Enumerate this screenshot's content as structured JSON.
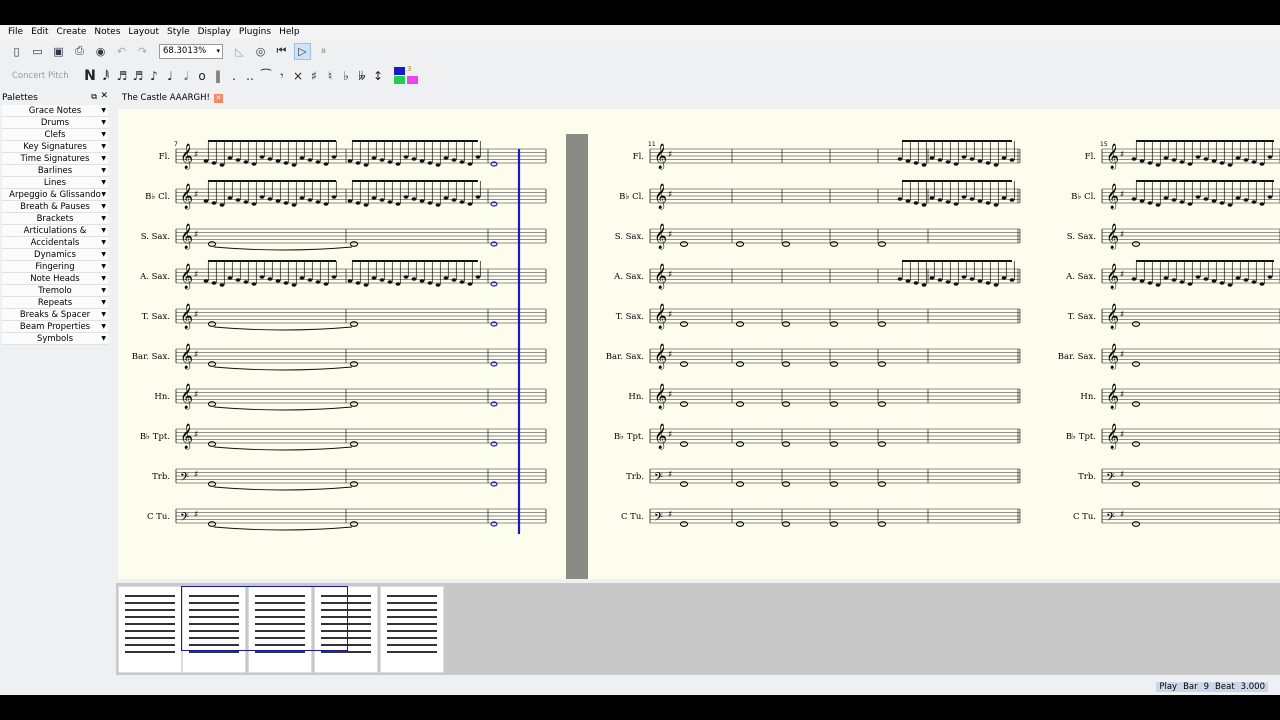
{
  "menu": [
    "File",
    "Edit",
    "Create",
    "Notes",
    "Layout",
    "Style",
    "Display",
    "Plugins",
    "Help"
  ],
  "toolbar": {
    "zoom": "68.3013%",
    "icons": [
      "new-file-icon",
      "open-file-icon",
      "save-icon",
      "print-icon",
      "mixer-icon",
      "undo-icon",
      "redo-icon"
    ],
    "playback_icons": [
      "metronome-icon",
      "loop-icon",
      "rewind-icon",
      "play-icon",
      "pause-icon"
    ]
  },
  "note_input": {
    "concert_pitch": "Concert Pitch",
    "note_mode": "N",
    "voices_label": "3",
    "voice_colors": [
      "#1a1acc",
      "#ee44ee",
      "#22cc55",
      "#3344ff"
    ]
  },
  "palettes": {
    "title": "Palettes",
    "items": [
      "Grace Notes",
      "Drums",
      "Clefs",
      "Key Signatures",
      "Time Signatures",
      "Barlines",
      "Lines",
      "Arpeggio & Glissando",
      "Breath & Pauses",
      "Brackets",
      "Articulations & Ornaments",
      "Accidentals",
      "Dynamics",
      "Fingering",
      "Note Heads",
      "Tremolo",
      "Repeats",
      "Breaks & Spacer",
      "Beam Properties",
      "Symbols"
    ]
  },
  "score_tab": {
    "title": "The Castle AAARGH!"
  },
  "instruments": [
    "Fl.",
    "B♭ Cl.",
    "S. Sax.",
    "A. Sax.",
    "T. Sax.",
    "Bar. Sax.",
    "Hn.",
    "B♭ Tpt.",
    "Trb.",
    "C Tu."
  ],
  "systems": [
    {
      "first_measure": "7"
    },
    {
      "first_measure": "11"
    },
    {
      "first_measure": "15"
    }
  ],
  "status": {
    "mode": "Play",
    "bar_label": "Bar",
    "bar": "9",
    "beat_label": "Beat",
    "beat": "3.000"
  },
  "colors": {
    "score_bg": "#fdfdee",
    "cursor": "#1a1acc",
    "separator": "#888c84"
  }
}
